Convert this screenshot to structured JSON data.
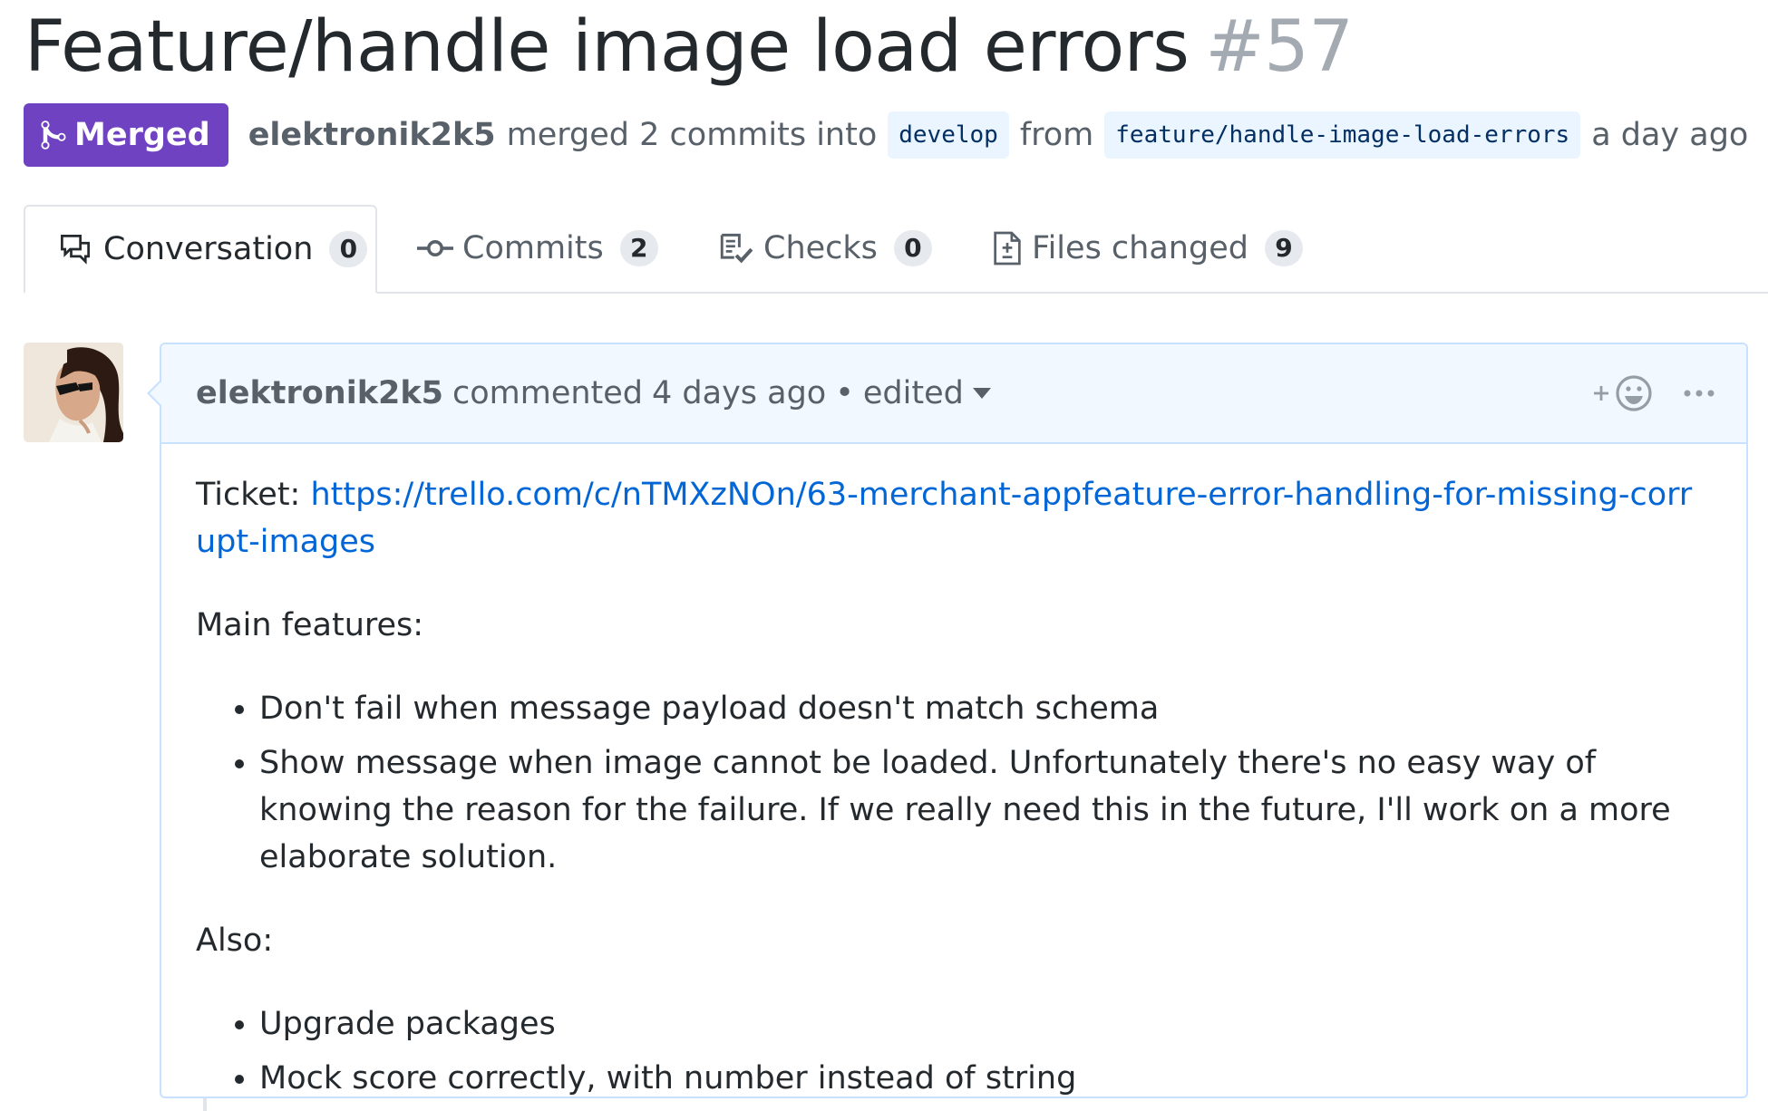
{
  "pr": {
    "title": "Feature/handle image load errors",
    "number": "#57",
    "state": "Merged",
    "author": "elektronik2k5",
    "action": "merged 2 commits into",
    "base_branch": "develop",
    "from_text": "from",
    "head_branch": "feature/handle-image-load-errors",
    "time": "a day ago"
  },
  "tabs": [
    {
      "label": "Conversation",
      "count": "0",
      "icon": "comment-discussion-icon",
      "selected": true
    },
    {
      "label": "Commits",
      "count": "2",
      "icon": "git-commit-icon",
      "selected": false
    },
    {
      "label": "Checks",
      "count": "0",
      "icon": "checklist-icon",
      "selected": false
    },
    {
      "label": "Files changed",
      "count": "9",
      "icon": "file-diff-icon",
      "selected": false
    }
  ],
  "comment": {
    "author": "elektronik2k5",
    "action": "commented",
    "time": "4 days ago",
    "separator": "•",
    "edited": "edited",
    "reaction_icon": "smiley-icon",
    "menu_icon": "kebab-horizontal-icon",
    "body": {
      "ticket_label": "Ticket:",
      "ticket_link": "https://trello.com/c/nTMXzNOn/63-merchant-appfeature-error-handling-for-missing-corrupt-images",
      "main_heading": "Main features:",
      "main_items": [
        "Don't fail when message payload doesn't match schema",
        "Show message when image cannot be loaded. Unfortunately there's no easy way of knowing the reason for the failure. If we really need this in the future, I'll work on a more elaborate solution."
      ],
      "also_heading": "Also:",
      "also_items": [
        "Upgrade packages",
        "Mock score correctly, with number instead of string"
      ]
    }
  },
  "colors": {
    "merged_purple": "#6f42c1",
    "link_blue": "#0366d6",
    "header_bg": "#f1f8ff",
    "border_blue": "#c8e1ff",
    "muted_text": "#586069",
    "branch_bg": "#eaf5ff"
  }
}
